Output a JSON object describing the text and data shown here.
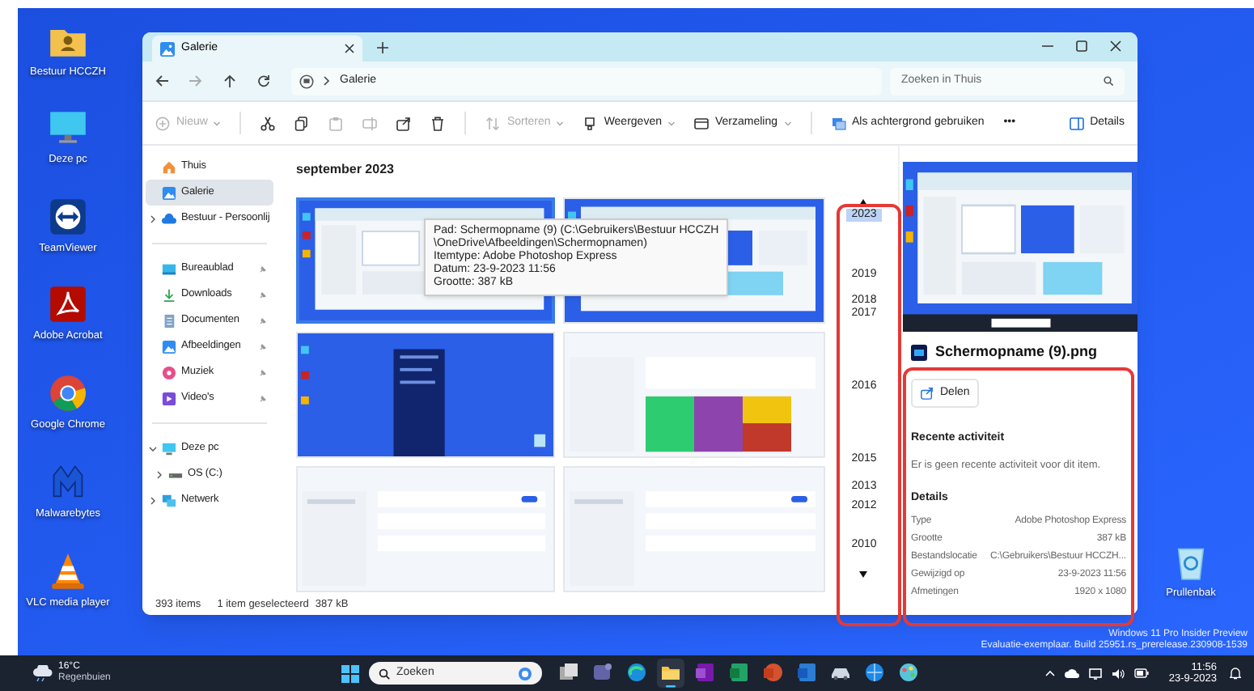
{
  "desktop_icons": [
    {
      "label": "Bestuur HCCZH"
    },
    {
      "label": "Deze pc"
    },
    {
      "label": "TeamViewer"
    },
    {
      "label": "Adobe Acrobat"
    },
    {
      "label": "Google Chrome"
    },
    {
      "label": "Malwarebytes"
    },
    {
      "label": "VLC media player"
    },
    {
      "label": "Prullenbak"
    }
  ],
  "window": {
    "tabs": [
      {
        "label": "Galerie",
        "selected": true
      }
    ],
    "address": {
      "path": [
        "Galerie"
      ]
    },
    "search": {
      "placeholder": "Zoeken in Thuis"
    },
    "toolbar": [
      {
        "kind": "dropdown",
        "label": "Nieuw",
        "disabled": true
      },
      {
        "kind": "icon",
        "disabled": false
      },
      {
        "kind": "icon",
        "disabled": false
      },
      {
        "kind": "icon",
        "disabled": true
      },
      {
        "kind": "icon",
        "disabled": true
      },
      {
        "kind": "icon",
        "disabled": false
      },
      {
        "kind": "icon",
        "disabled": false
      },
      {
        "kind": "dropdown",
        "label": "Sorteren",
        "disabled": true
      },
      {
        "kind": "dropdown",
        "label": "Weergeven",
        "disabled": false
      },
      {
        "kind": "dropdown",
        "label": "Verzameling",
        "disabled": false
      },
      {
        "kind": "button",
        "label": "Als achtergrond gebruiken",
        "disabled": false
      },
      {
        "kind": "button",
        "label": "•••",
        "disabled": false
      },
      {
        "kind": "toggle",
        "label": "Details",
        "disabled": false
      }
    ],
    "navigation": [
      {
        "items": [
          {
            "label": "Thuis",
            "selected": false
          },
          {
            "label": "Galerie",
            "selected": true
          },
          {
            "label": "Bestuur - Persoonlij",
            "selected": false,
            "expanded": false
          }
        ]
      },
      {
        "items": [
          {
            "label": "Bureaublad",
            "selected": false,
            "pinned": true
          },
          {
            "label": "Downloads",
            "selected": false,
            "pinned": true
          },
          {
            "label": "Documenten",
            "selected": false,
            "pinned": true
          },
          {
            "label": "Afbeeldingen",
            "selected": false,
            "pinned": true
          },
          {
            "label": "Muziek",
            "selected": false,
            "pinned": true
          },
          {
            "label": "Video's",
            "selected": false,
            "pinned": true
          }
        ]
      },
      {
        "items": [
          {
            "label": "Deze pc",
            "selected": false,
            "expanded": true,
            "children": [
              {
                "label": "OS (C:)",
                "selected": false,
                "expanded": false
              }
            ]
          },
          {
            "label": "Netwerk",
            "selected": false,
            "expanded": false
          }
        ]
      }
    ],
    "gallery": {
      "heading": "september 2023",
      "items": [
        {
          "selected": true
        },
        {
          "selected": false
        },
        {
          "selected": false
        },
        {
          "selected": false
        },
        {
          "selected": false
        },
        {
          "selected": false
        }
      ]
    },
    "tooltip": {
      "lines": [
        "Pad: Schermopname (9) (C:\\Gebruikers\\Bestuur HCCZH",
        "\\OneDrive\\Afbeeldingen\\Schermopnamen)",
        "Itemtype: Adobe Photoshop Express",
        "Datum: 23-9-2023 11:56",
        "Grootte: 387 kB"
      ]
    },
    "timeline": {
      "highlighted": true,
      "years": [
        {
          "label": "2023",
          "selected": true
        },
        {
          "label": "2019",
          "selected": false
        },
        {
          "label": "2018",
          "selected": false
        },
        {
          "label": "2017",
          "selected": false
        },
        {
          "label": "2016",
          "selected": false
        },
        {
          "label": "2015",
          "selected": false
        },
        {
          "label": "2013",
          "selected": false
        },
        {
          "label": "2012",
          "selected": false
        },
        {
          "label": "2010",
          "selected": false
        }
      ]
    },
    "details_pane": {
      "highlighted": true,
      "file_name": "Schermopname (9).png",
      "share_button": "Delen",
      "recent_heading": "Recente activiteit",
      "recent_text": "Er is geen recente activiteit voor dit item.",
      "details_heading": "Details",
      "properties": [
        {
          "name": "Type",
          "value": "Adobe Photoshop Express"
        },
        {
          "name": "Grootte",
          "value": "387 kB"
        },
        {
          "name": "Bestandslocatie",
          "value": "C:\\Gebruikers\\Bestuur HCCZH..."
        },
        {
          "name": "Gewijzigd op",
          "value": "23-9-2023 11:56"
        },
        {
          "name": "Afmetingen",
          "value": "1920 x 1080"
        }
      ]
    },
    "status_bar": {
      "item_count": "393 items",
      "selection": "1 item geselecteerd",
      "size": "387 kB"
    }
  },
  "build_notice": [
    "Windows 11 Pro Insider Preview",
    "Evaluatie-exemplaar. Build 25951.rs_prerelease.230908-1539"
  ],
  "taskbar": {
    "weather": {
      "temperature": "16°C",
      "condition": "Regenbuien"
    },
    "search": {
      "placeholder": "Zoeken"
    },
    "apps": [
      {
        "selected": false
      },
      {
        "selected": false
      },
      {
        "selected": false
      },
      {
        "selected": true
      },
      {
        "selected": false
      },
      {
        "selected": false
      },
      {
        "selected": false
      },
      {
        "selected": false
      },
      {
        "selected": false
      },
      {
        "selected": false
      },
      {
        "selected": false
      }
    ],
    "clock": {
      "time": "11:56",
      "date": "23-9-2023"
    }
  }
}
